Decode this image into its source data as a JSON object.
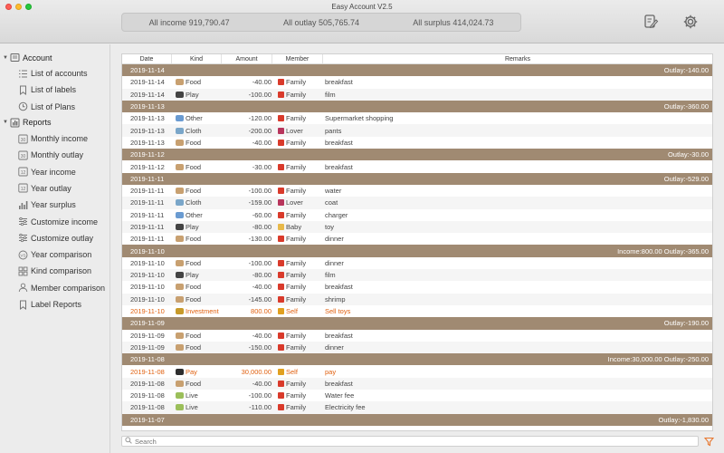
{
  "window": {
    "title": "Easy Account V2.5"
  },
  "summary": {
    "income": "All income 919,790.47",
    "outlay": "All outlay 505,765.74",
    "surplus": "All surplus 414,024.73"
  },
  "sidebar": {
    "groups": [
      {
        "label": "Account",
        "icon": "account-icon",
        "items": [
          {
            "label": "List of accounts",
            "icon": "list-icon"
          },
          {
            "label": "List of labels",
            "icon": "bookmark-icon"
          },
          {
            "label": "List of Plans",
            "icon": "clock-icon"
          }
        ]
      },
      {
        "label": "Reports",
        "icon": "report-icon",
        "items": [
          {
            "label": "Monthly income",
            "icon": "calendar-30-icon"
          },
          {
            "label": "Monthly outlay",
            "icon": "calendar-30-icon"
          },
          {
            "label": "Year income",
            "icon": "calendar-12-icon"
          },
          {
            "label": "Year outlay",
            "icon": "calendar-12-icon"
          },
          {
            "label": "Year surplus",
            "icon": "bar-chart-icon"
          },
          {
            "label": "Customize income",
            "icon": "sliders-icon"
          },
          {
            "label": "Customize outlay",
            "icon": "sliders-icon"
          },
          {
            "label": "Year comparison",
            "icon": "vs-icon"
          },
          {
            "label": "Kind comparison",
            "icon": "grid-icon"
          },
          {
            "label": "Member comparison",
            "icon": "person-icon"
          },
          {
            "label": "Label Reports",
            "icon": "bookmark-icon"
          }
        ]
      }
    ]
  },
  "table": {
    "headers": {
      "date": "Date",
      "kind": "Kind",
      "amount": "Amount",
      "member": "Member",
      "remarks": "Remarks"
    },
    "groups": [
      {
        "date": "2019-11-14",
        "total": "Outlay:-140.00",
        "rows": [
          {
            "date": "2019-11-14",
            "kind": "Food",
            "amount": "-40.00",
            "member": "Family",
            "remarks": "breakfast"
          },
          {
            "date": "2019-11-14",
            "kind": "Play",
            "amount": "-100.00",
            "member": "Family",
            "remarks": "film"
          }
        ]
      },
      {
        "date": "2019-11-13",
        "total": "Outlay:-360.00",
        "rows": [
          {
            "date": "2019-11-13",
            "kind": "Other",
            "amount": "-120.00",
            "member": "Family",
            "remarks": "Supermarket shopping"
          },
          {
            "date": "2019-11-13",
            "kind": "Cloth",
            "amount": "-200.00",
            "member": "Lover",
            "remarks": "pants"
          },
          {
            "date": "2019-11-13",
            "kind": "Food",
            "amount": "-40.00",
            "member": "Family",
            "remarks": "breakfast"
          }
        ]
      },
      {
        "date": "2019-11-12",
        "total": "Outlay:-30.00",
        "rows": [
          {
            "date": "2019-11-12",
            "kind": "Food",
            "amount": "-30.00",
            "member": "Family",
            "remarks": " breakfast"
          }
        ]
      },
      {
        "date": "2019-11-11",
        "total": "Outlay:-529.00",
        "rows": [
          {
            "date": "2019-11-11",
            "kind": "Food",
            "amount": "-100.00",
            "member": "Family",
            "remarks": "water"
          },
          {
            "date": "2019-11-11",
            "kind": "Cloth",
            "amount": "-159.00",
            "member": "Lover",
            "remarks": "coat"
          },
          {
            "date": "2019-11-11",
            "kind": "Other",
            "amount": "-60.00",
            "member": "Family",
            "remarks": "charger"
          },
          {
            "date": "2019-11-11",
            "kind": "Play",
            "amount": "-80.00",
            "member": "Baby",
            "remarks": "toy"
          },
          {
            "date": "2019-11-11",
            "kind": "Food",
            "amount": "-130.00",
            "member": "Family",
            "remarks": "dinner"
          }
        ]
      },
      {
        "date": "2019-11-10",
        "total": "Income:800.00  Outlay:-365.00",
        "rows": [
          {
            "date": "2019-11-10",
            "kind": "Food",
            "amount": "-100.00",
            "member": "Family",
            "remarks": "dinner"
          },
          {
            "date": "2019-11-10",
            "kind": "Play",
            "amount": "-80.00",
            "member": "Family",
            "remarks": "film"
          },
          {
            "date": "2019-11-10",
            "kind": "Food",
            "amount": "-40.00",
            "member": "Family",
            "remarks": "breakfast"
          },
          {
            "date": "2019-11-10",
            "kind": "Food",
            "amount": "-145.00",
            "member": "Family",
            "remarks": "shrimp"
          },
          {
            "date": "2019-11-10",
            "kind": "Investment",
            "amount": "800.00",
            "member": "Self",
            "remarks": "Sell toys",
            "income": true
          }
        ]
      },
      {
        "date": "2019-11-09",
        "total": "Outlay:-190.00",
        "rows": [
          {
            "date": "2019-11-09",
            "kind": "Food",
            "amount": "-40.00",
            "member": "Family",
            "remarks": "breakfast"
          },
          {
            "date": "2019-11-09",
            "kind": "Food",
            "amount": "-150.00",
            "member": "Family",
            "remarks": "dinner"
          }
        ]
      },
      {
        "date": "2019-11-08",
        "total": "Income:30,000.00  Outlay:-250.00",
        "rows": [
          {
            "date": "2019-11-08",
            "kind": "Pay",
            "amount": "30,000.00",
            "member": "Self",
            "remarks": "pay",
            "income": true
          },
          {
            "date": "2019-11-08",
            "kind": "Food",
            "amount": "-40.00",
            "member": "Family",
            "remarks": "breakfast"
          },
          {
            "date": "2019-11-08",
            "kind": "Live",
            "amount": "-100.00",
            "member": "Family",
            "remarks": "Water fee"
          },
          {
            "date": "2019-11-08",
            "kind": "Live",
            "amount": "-110.00",
            "member": "Family",
            "remarks": "Electricity fee"
          }
        ]
      },
      {
        "date": "2019-11-07",
        "total": "Outlay:-1,830.00",
        "rows": []
      }
    ]
  },
  "search": {
    "placeholder": "Search"
  },
  "colors": {
    "group_bar": "#a08a72",
    "income_text": "#e0600f",
    "filter_icon": "#e8762d"
  }
}
